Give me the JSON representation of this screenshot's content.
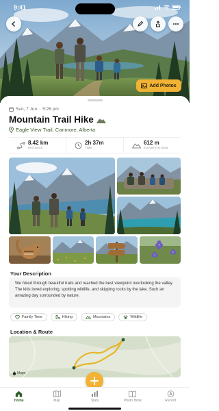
{
  "status_bar": {
    "time": "9:41"
  },
  "hero": {
    "add_photos_label": "Add Photos",
    "colors": {
      "accent": "#f2b233"
    }
  },
  "hike": {
    "date": "Sun, 7 Jun",
    "time": "5:26 pm",
    "title": "Mountain Trail Hike",
    "title_icon": "mountain-icon",
    "location": "Eagle View Trail, Canmore, Alberta"
  },
  "stats": [
    {
      "value": "8.42 km",
      "label": "DISTANCE",
      "icon": "route-icon"
    },
    {
      "value": "2h 37m",
      "label": "TIME",
      "icon": "clock-icon"
    },
    {
      "value": "612 m",
      "label": "ELEVATION GAIN",
      "icon": "elevation-icon"
    }
  ],
  "description": {
    "heading": "Your Description",
    "text": "We hiked through beautiful trails and reached the best viewpoint overlooking the valley. The kids loved exploring, spotting wildlife, and skipping rocks by the lake. Such an amazing day surrounded by nature."
  },
  "tags": [
    {
      "label": "Family Time",
      "icon": "heart-icon"
    },
    {
      "label": "Hiking",
      "icon": "boot-icon"
    },
    {
      "label": "Mountains",
      "icon": "mountain-icon"
    },
    {
      "label": "Wildlife",
      "icon": "paw-icon"
    }
  ],
  "location_route": {
    "heading": "Location & Route",
    "map_attribution": "Maps"
  },
  "tabbar": {
    "tabs": [
      {
        "label": "Home",
        "icon": "home-icon",
        "active": true
      },
      {
        "label": "Map",
        "icon": "map-icon",
        "active": false
      },
      {
        "label": "Stats",
        "icon": "stats-icon",
        "active": false
      },
      {
        "label": "Photo Book",
        "icon": "book-icon",
        "active": false
      },
      {
        "label": "Record",
        "icon": "record-icon",
        "active": false
      }
    ]
  },
  "colors": {
    "primary_green": "#2f5d2a",
    "accent_yellow": "#f2b233",
    "route_yellow": "#e8b628"
  }
}
